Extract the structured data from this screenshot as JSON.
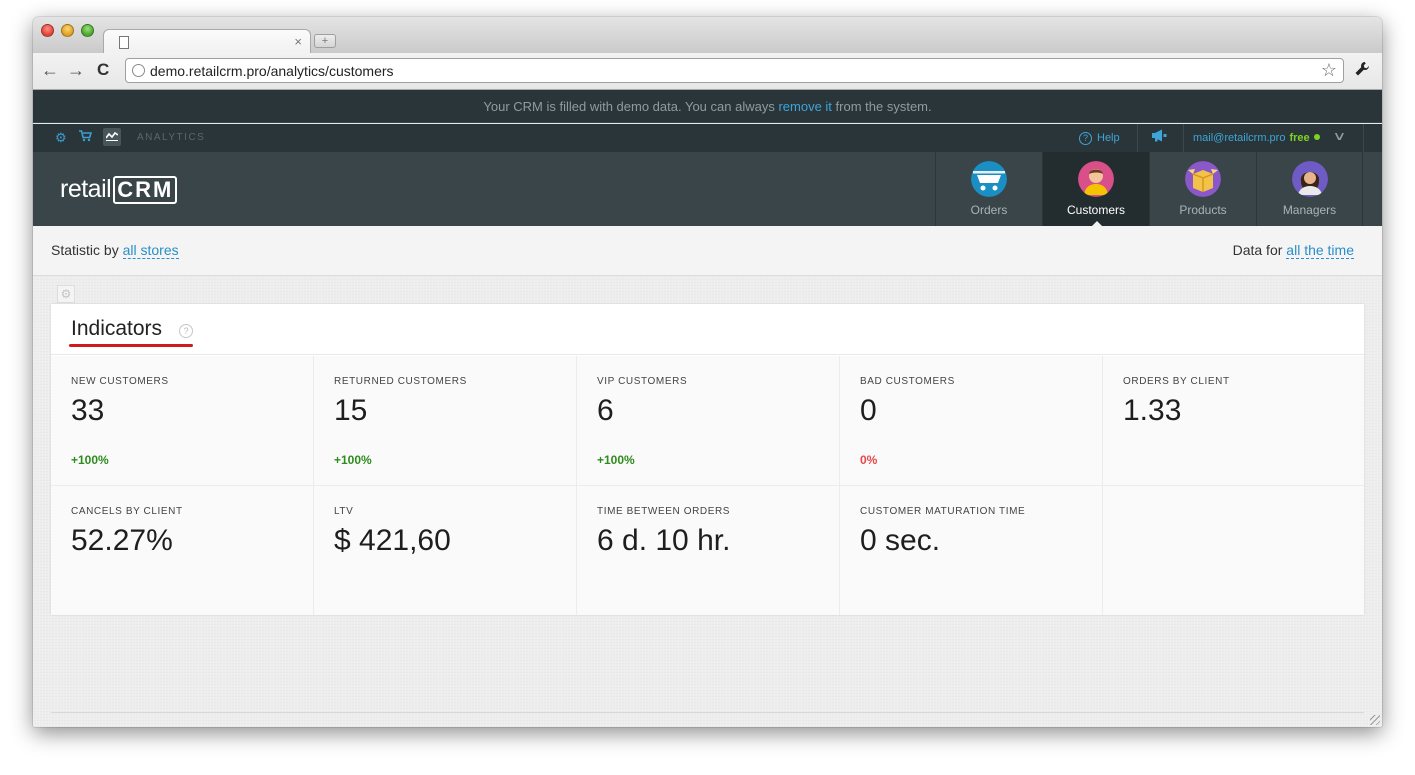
{
  "browser": {
    "tab_close": "×",
    "newtab_symbol": "+",
    "back_icon": "←",
    "forward_icon": "→",
    "reload_icon": "C",
    "url": "demo.retailcrm.pro/analytics/customers",
    "star_icon": "☆",
    "wrench_icon": "🔧"
  },
  "notice": {
    "text_before": "Your CRM is filled with demo data. You can always ",
    "link": "remove it",
    "text_after": " from the system."
  },
  "topnav": {
    "analytics_label": "ANALYTICS",
    "help_label": "Help",
    "user_email": "mail@retailcrm.pro",
    "plan": "free",
    "gear_icon": "⚙",
    "cart_icon": "🛒",
    "chart_icon": "⌇",
    "chevron_icon": "∨"
  },
  "header": {
    "logo_text": "retail",
    "logo_crm": "CRM",
    "nav": [
      {
        "label": "Orders",
        "color": "#1a8fc4"
      },
      {
        "label": "Customers",
        "color": "#d94f8a"
      },
      {
        "label": "Products",
        "color": "#8b58c9"
      },
      {
        "label": "Managers",
        "color": "#6f5bc4"
      }
    ]
  },
  "filters": {
    "statistic_by": "Statistic by",
    "stores_link": "all stores",
    "data_for": "Data for",
    "time_link": "all the time"
  },
  "indicators": {
    "title": "Indicators",
    "help_icon": "?",
    "items": [
      {
        "label": "NEW CUSTOMERS",
        "value": "33",
        "delta": "+100%"
      },
      {
        "label": "RETURNED CUSTOMERS",
        "value": "15",
        "delta": "+100%"
      },
      {
        "label": "VIP CUSTOMERS",
        "value": "6",
        "delta": "+100%"
      },
      {
        "label": "BAD CUSTOMERS",
        "value": "0",
        "delta": "0%"
      },
      {
        "label": "ORDERS BY CLIENT",
        "value": "1.33",
        "delta": ""
      },
      {
        "label": "CANCELS BY CLIENT",
        "value": "52.27%",
        "delta": ""
      },
      {
        "label": "LTV",
        "value": "$ 421,60",
        "delta": ""
      },
      {
        "label": "TIME BETWEEN ORDERS",
        "value": "6 d. 10 hr.",
        "delta": ""
      },
      {
        "label": "CUSTOMER MATURATION TIME",
        "value": "0 sec.",
        "delta": ""
      }
    ]
  },
  "colors": {
    "link": "#2a8fc7",
    "positive": "#2e8b1e",
    "negative": "#e8464b",
    "header_bg": "#394549",
    "accent_underline": "#d11a1a"
  }
}
